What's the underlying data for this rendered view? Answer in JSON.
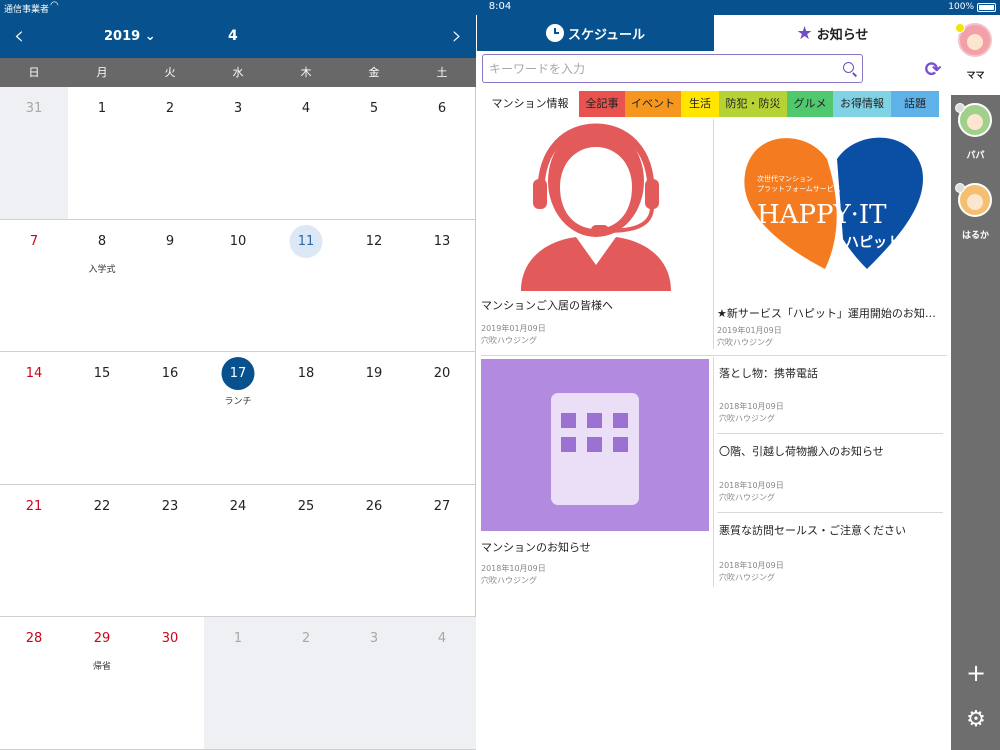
{
  "status": {
    "carrier": "通信事業者",
    "time": "8:04",
    "battery": "100%"
  },
  "calendar": {
    "year": "2019",
    "month": "4",
    "weekdays": [
      "日",
      "月",
      "火",
      "水",
      "木",
      "金",
      "土"
    ],
    "weeks": [
      [
        {
          "d": "31",
          "dim": true,
          "sun": true
        },
        {
          "d": "1"
        },
        {
          "d": "2"
        },
        {
          "d": "3"
        },
        {
          "d": "4"
        },
        {
          "d": "5"
        },
        {
          "d": "6"
        }
      ],
      [
        {
          "d": "7",
          "sun": true
        },
        {
          "d": "8",
          "event": "入学式"
        },
        {
          "d": "9"
        },
        {
          "d": "10"
        },
        {
          "d": "11",
          "today": true
        },
        {
          "d": "12"
        },
        {
          "d": "13"
        }
      ],
      [
        {
          "d": "14",
          "sun": true
        },
        {
          "d": "15"
        },
        {
          "d": "16"
        },
        {
          "d": "17",
          "selected": true,
          "event": "ランチ"
        },
        {
          "d": "18"
        },
        {
          "d": "19"
        },
        {
          "d": "20"
        }
      ],
      [
        {
          "d": "21",
          "sun": true
        },
        {
          "d": "22"
        },
        {
          "d": "23"
        },
        {
          "d": "24"
        },
        {
          "d": "25"
        },
        {
          "d": "26"
        },
        {
          "d": "27"
        }
      ],
      [
        {
          "d": "28",
          "sun": true
        },
        {
          "d": "29",
          "sun": true,
          "event": "帰省"
        },
        {
          "d": "30",
          "sun": true
        },
        {
          "d": "1",
          "dim": true
        },
        {
          "d": "2",
          "dim": true
        },
        {
          "d": "3",
          "dim": true
        },
        {
          "d": "4",
          "dim": true
        }
      ]
    ]
  },
  "tabs": {
    "schedule": "スケジュール",
    "notice": "お知らせ"
  },
  "search": {
    "placeholder": "キーワードを入力"
  },
  "categories": [
    {
      "label": "マンション情報",
      "color": "#ffffff"
    },
    {
      "label": "全記事",
      "color": "#e8524f"
    },
    {
      "label": "イベント",
      "color": "#f5961e"
    },
    {
      "label": "生活",
      "color": "#ffe500"
    },
    {
      "label": "防犯・防災",
      "color": "#b5d334"
    },
    {
      "label": "グルメ",
      "color": "#4fc86e"
    },
    {
      "label": "お得情報",
      "color": "#7fd3e4"
    },
    {
      "label": "話題",
      "color": "#5fb2e8"
    }
  ],
  "articles": {
    "a1": {
      "title": "マンションご入居の皆様へ",
      "date": "2019年01月09日",
      "author": "穴吹ハウジング"
    },
    "a2": {
      "title": "★新サービス「ハピット」運用開始のお知らせ",
      "date": "2019年01月09日",
      "author": "穴吹ハウジング",
      "logo_line1": "次世代マンション",
      "logo_line2": "プラットフォームサービス",
      "logo_main": "HAPPY·IT",
      "logo_sub": "ハピット"
    },
    "a3": {
      "title": "マンションのお知らせ",
      "date": "2018年10月09日",
      "author": "穴吹ハウジング"
    },
    "a4": {
      "title": "落とし物：携帯電話",
      "date": "2018年10月09日",
      "author": "穴吹ハウジング"
    },
    "a5": {
      "title": "〇階、引越し荷物搬入のお知らせ",
      "date": "2018年10月09日",
      "author": "穴吹ハウジング"
    },
    "a6": {
      "title": "悪質な訪問セールス・ご注意ください",
      "date": "2018年10月09日",
      "author": "穴吹ハウジング"
    }
  },
  "members": [
    {
      "label": "ママ",
      "dot": "#f2e500",
      "avatar": "#f4a0a8"
    },
    {
      "label": "パパ",
      "dot": "#dddddd",
      "avatar": "#9fd18a"
    },
    {
      "label": "はるか",
      "dot": "#dddddd",
      "avatar": "#f4c070"
    }
  ],
  "icons": {
    "add": "plus-icon",
    "settings": "gear-icon",
    "refresh": "refresh-icon",
    "search": "search-icon"
  }
}
